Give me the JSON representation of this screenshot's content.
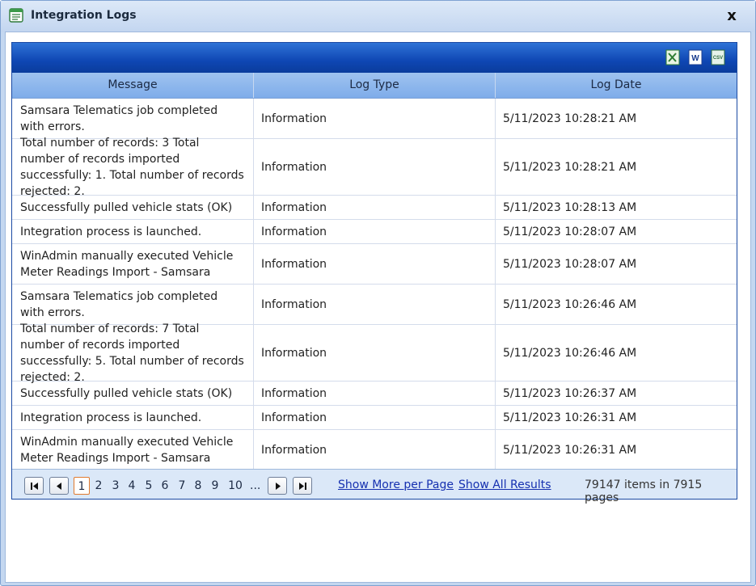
{
  "window": {
    "title": "Integration Logs",
    "close_label": "x"
  },
  "toolbar": {
    "exports": [
      {
        "name": "export-excel-button",
        "glyph": "excel-icon"
      },
      {
        "name": "export-word-button",
        "glyph": "word-icon",
        "label": "W"
      },
      {
        "name": "export-csv-button",
        "glyph": "csv-icon",
        "label": "CSV"
      }
    ]
  },
  "grid": {
    "columns": [
      "Message",
      "Log Type",
      "Log Date"
    ],
    "rows": [
      {
        "message": "Samsara Telematics job completed with errors.",
        "type": "Information",
        "date": "5/11/2023 10:28:21 AM"
      },
      {
        "message": "Total number of records: 3 Total number of records imported successfully: 1. Total number of records rejected: 2.",
        "type": "Information",
        "date": "5/11/2023 10:28:21 AM"
      },
      {
        "message": "Successfully pulled vehicle stats (OK)",
        "type": "Information",
        "date": "5/11/2023 10:28:13 AM"
      },
      {
        "message": "Integration process is launched.",
        "type": "Information",
        "date": "5/11/2023 10:28:07 AM"
      },
      {
        "message": "WinAdmin manually executed Vehicle Meter Readings Import - Samsara",
        "type": "Information",
        "date": "5/11/2023 10:28:07 AM"
      },
      {
        "message": "Samsara Telematics job completed with errors.",
        "type": "Information",
        "date": "5/11/2023 10:26:46 AM"
      },
      {
        "message": "Total number of records: 7 Total number of records imported successfully: 5. Total number of records rejected: 2.",
        "type": "Information",
        "date": "5/11/2023 10:26:46 AM"
      },
      {
        "message": "Successfully pulled vehicle stats (OK)",
        "type": "Information",
        "date": "5/11/2023 10:26:37 AM"
      },
      {
        "message": "Integration process is launched.",
        "type": "Information",
        "date": "5/11/2023 10:26:31 AM"
      },
      {
        "message": "WinAdmin manually executed Vehicle Meter Readings Import - Samsara",
        "type": "Information",
        "date": "5/11/2023 10:26:31 AM"
      }
    ]
  },
  "pager": {
    "pages": [
      "1",
      "2",
      "3",
      "4",
      "5",
      "6",
      "7",
      "8",
      "9",
      "10",
      "..."
    ],
    "current_page": "1",
    "show_more_label": "Show More per Page",
    "show_all_label": "Show All Results",
    "item_count": "79147",
    "items_in_label": "items in",
    "page_count": "7915",
    "pages_label": "pages"
  }
}
